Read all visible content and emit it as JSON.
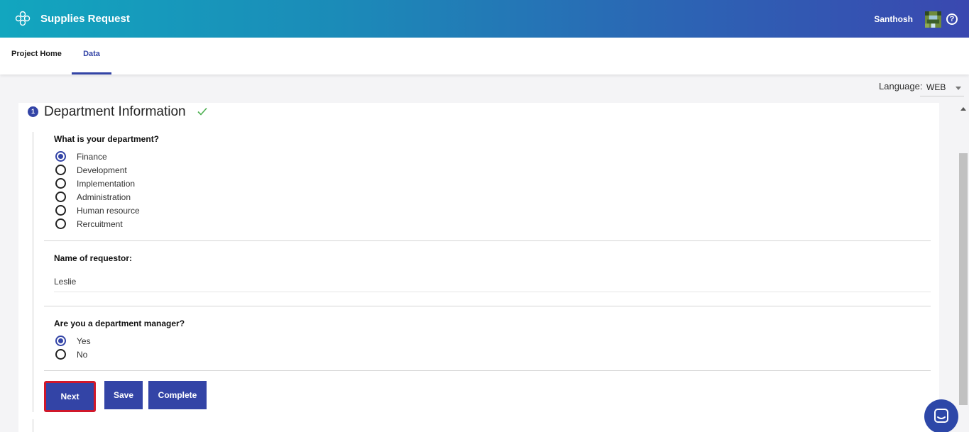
{
  "header": {
    "app_title": "Supplies Request",
    "user_name": "Santhosh",
    "logo_icon": "flower-logo-icon",
    "help_icon": "help-icon"
  },
  "nav": {
    "tabs": [
      {
        "label": "Project Home",
        "active": false
      },
      {
        "label": "Data",
        "active": true
      }
    ]
  },
  "language": {
    "label": "Language:",
    "selected": "WEB"
  },
  "section": {
    "step_number": "1",
    "title": "Department Information",
    "completed": true,
    "department": {
      "question": "What is your department?",
      "options": [
        "Finance",
        "Development",
        "Implementation",
        "Administration",
        "Human resource",
        "Rercuitment"
      ],
      "selected": "Finance"
    },
    "requestor": {
      "question": "Name of requestor:",
      "value": "Leslie"
    },
    "manager": {
      "question": "Are you a department manager?",
      "options": [
        "Yes",
        "No"
      ],
      "selected": "Yes"
    }
  },
  "buttons": {
    "next": "Next",
    "save": "Save",
    "complete": "Complete"
  },
  "colors": {
    "primary": "#3344a6",
    "header_start": "#12a6bf",
    "header_end": "#3a48b0",
    "focus_outline": "#d0182b",
    "check": "#4caf50"
  }
}
